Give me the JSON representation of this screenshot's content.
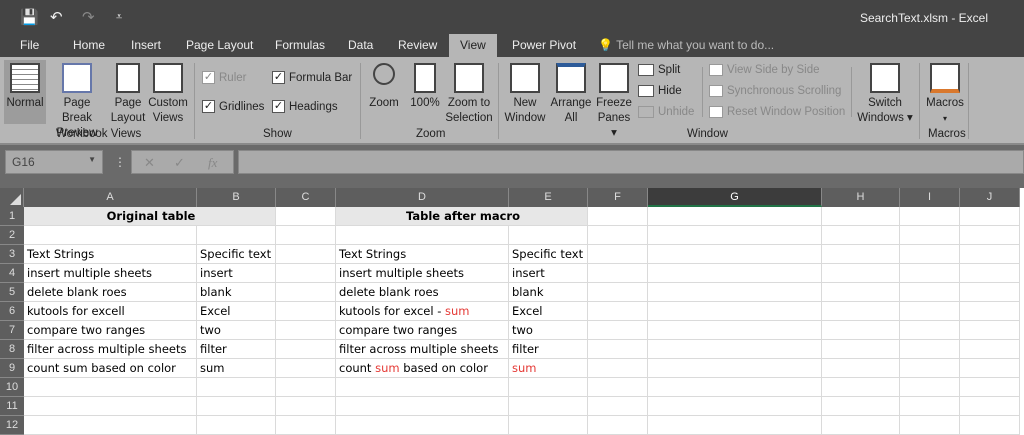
{
  "window": {
    "title": "SearchText.xlsm - Excel"
  },
  "qat": {
    "save": "💾",
    "undo": "↶",
    "redo": "↷",
    "customize": "⩡"
  },
  "tabs": [
    "File",
    "Home",
    "Insert",
    "Page Layout",
    "Formulas",
    "Data",
    "Review",
    "View",
    "Power Pivot"
  ],
  "active_tab": "View",
  "tell_me": "Tell me what you want to do...",
  "ribbon": {
    "workbook_views": {
      "label": "Workbook Views",
      "normal": "Normal",
      "page_break": [
        "Page Break",
        "Preview"
      ],
      "page_layout": [
        "Page",
        "Layout"
      ],
      "custom": [
        "Custom",
        "Views"
      ]
    },
    "show": {
      "label": "Show",
      "ruler": "Ruler",
      "formula_bar": "Formula Bar",
      "gridlines": "Gridlines",
      "headings": "Headings",
      "ruler_checked": true,
      "formula_bar_checked": true,
      "gridlines_checked": true,
      "headings_checked": true
    },
    "zoom": {
      "label": "Zoom",
      "zoom": "Zoom",
      "hundred": "100%",
      "zoom_sel": [
        "Zoom to",
        "Selection"
      ]
    },
    "window": {
      "label": "Window",
      "new": [
        "New",
        "Window"
      ],
      "arrange": [
        "Arrange",
        "All"
      ],
      "freeze": [
        "Freeze",
        "Panes ▾"
      ],
      "split": "Split",
      "hide": "Hide",
      "unhide": "Unhide",
      "side": "View Side by Side",
      "sync": "Synchronous Scrolling",
      "reset": "Reset Window Position",
      "switch": [
        "Switch",
        "Windows ▾"
      ]
    },
    "macros": {
      "label": "Macros",
      "macros": "Macros",
      "arrow": "▾"
    }
  },
  "formula_bar": {
    "name_box": "G16",
    "cancel": "✕",
    "enter": "✓",
    "fx": "fx",
    "value": ""
  },
  "columns": [
    "A",
    "B",
    "C",
    "D",
    "E",
    "F",
    "G",
    "H",
    "I",
    "J"
  ],
  "selected_column": "G",
  "rows": [
    "1",
    "2",
    "3",
    "4",
    "5",
    "6",
    "7",
    "8",
    "9",
    "10",
    "11",
    "12"
  ],
  "cells": {
    "A1": "Original table",
    "D1": "Table after macro",
    "A3": "Text Strings",
    "B3": "Specific text",
    "D3": "Text Strings",
    "E3": "Specific text",
    "A4": "insert multiple sheets",
    "B4": "insert",
    "D4": "insert multiple sheets",
    "E4": "insert",
    "A5": "delete blank roes",
    "B5": "blank",
    "D5": "delete blank roes",
    "E5": "blank",
    "A6": "kutools for excell",
    "B6": "Excel",
    "D6": [
      [
        "kutools for excel - ",
        ""
      ],
      [
        "sum",
        "red"
      ]
    ],
    "E6": "Excel",
    "A7": "compare two ranges",
    "B7": "two",
    "D7": "compare two ranges",
    "E7": "two",
    "A8": "filter across multiple sheets",
    "B8": "filter",
    "D8": "filter across multiple sheets",
    "E8": "filter",
    "A9": "count sum based on color",
    "B9": "sum",
    "D9": [
      [
        "count ",
        ""
      ],
      [
        "sum",
        "red"
      ],
      [
        " based on color",
        ""
      ]
    ],
    "E9": [
      [
        "sum",
        "red"
      ]
    ]
  },
  "colors": {
    "highlight": "#e53935",
    "header_fill": "#e7e7e7"
  }
}
